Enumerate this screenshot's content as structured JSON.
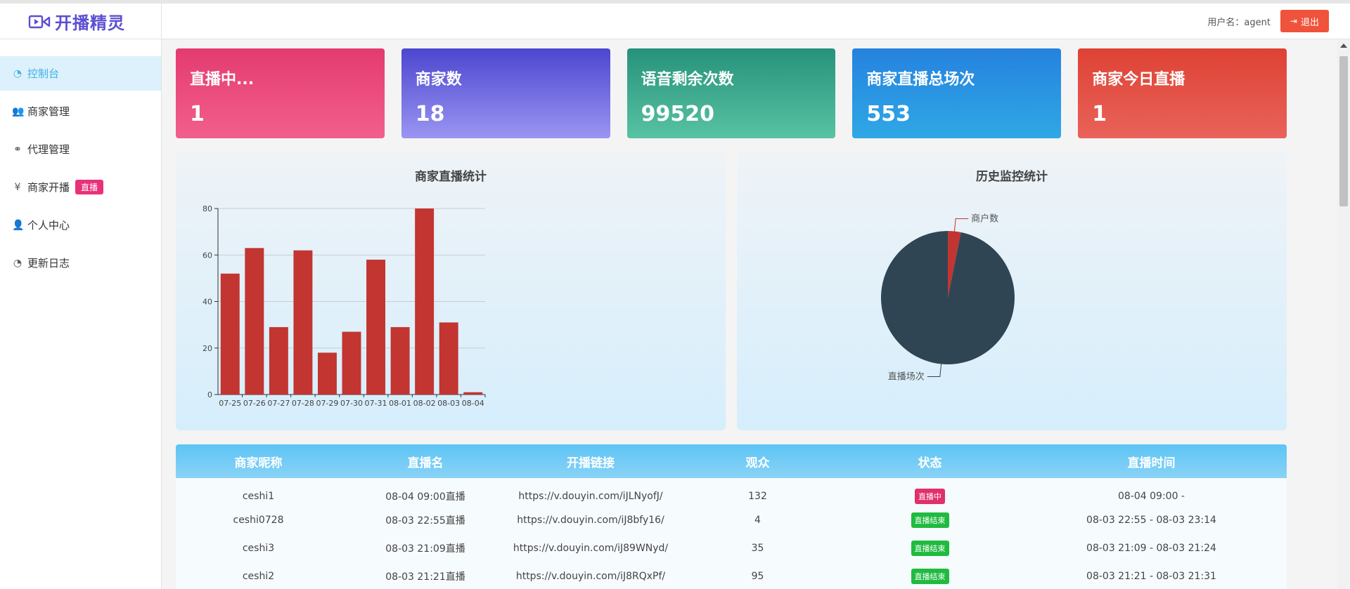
{
  "app": {
    "name": "开播精灵"
  },
  "header": {
    "user_label": "用户名：agent",
    "logout_label": "退出"
  },
  "sidebar": {
    "items": [
      {
        "label": "控制台",
        "icon": "dashboard-icon",
        "active": true
      },
      {
        "label": "商家管理",
        "icon": "users-icon"
      },
      {
        "label": "代理管理",
        "icon": "handshake-icon"
      },
      {
        "label": "商家开播",
        "icon": "yen-icon",
        "badge": "直播"
      },
      {
        "label": "个人中心",
        "icon": "user-icon"
      },
      {
        "label": "更新日志",
        "icon": "dashboard-icon"
      }
    ]
  },
  "cards": [
    {
      "title": "直播中...",
      "value": "1"
    },
    {
      "title": "商家数",
      "value": "18"
    },
    {
      "title": "语音剩余次数",
      "value": "99520"
    },
    {
      "title": "商家直播总场次",
      "value": "553"
    },
    {
      "title": "商家今日直播",
      "value": "1"
    }
  ],
  "chart_data": [
    {
      "type": "bar",
      "title": "商家直播统计",
      "categories": [
        "07-25",
        "07-26",
        "07-27",
        "07-28",
        "07-29",
        "07-30",
        "07-31",
        "08-01",
        "08-02",
        "08-03",
        "08-04"
      ],
      "values": [
        52,
        63,
        29,
        62,
        18,
        27,
        58,
        29,
        80,
        31,
        1
      ],
      "ylim": [
        0,
        80
      ],
      "yticks": [
        0,
        20,
        40,
        60,
        80
      ],
      "grid": true,
      "color": "#c23531"
    },
    {
      "type": "pie",
      "title": "历史监控统计",
      "labels": [
        "商户数",
        "直播场次"
      ],
      "values": [
        18,
        553
      ],
      "colors": [
        "#c23531",
        "#2f4554"
      ]
    }
  ],
  "table": {
    "headers": [
      "商家昵称",
      "直播名",
      "开播链接",
      "观众",
      "状态",
      "直播时间"
    ],
    "rows": [
      {
        "nick": "ceshi1",
        "name": "08-04 09:00直播",
        "link": "https://v.douyin.com/iJLNyofJ/",
        "viewers": "132",
        "status": "直播中",
        "status_color": "#e2306c",
        "time": "08-04 09:00 -"
      },
      {
        "nick": "ceshi0728",
        "name": "08-03 22:55直播",
        "link": "https://v.douyin.com/iJ8bfy16/",
        "viewers": "4",
        "status": "直播结束",
        "status_color": "#1fba3f",
        "time": "08-03 22:55 - 08-03 23:14"
      },
      {
        "nick": "ceshi3",
        "name": "08-03 21:09直播",
        "link": "https://v.douyin.com/iJ89WNyd/",
        "viewers": "35",
        "status": "直播结束",
        "status_color": "#1fba3f",
        "time": "08-03 21:09 - 08-03 21:24"
      },
      {
        "nick": "ceshi2",
        "name": "08-03 21:21直播",
        "link": "https://v.douyin.com/iJ8RQxPf/",
        "viewers": "95",
        "status": "直播结束",
        "status_color": "#1fba3f",
        "time": "08-03 21:21 - 08-03 21:31"
      }
    ]
  }
}
